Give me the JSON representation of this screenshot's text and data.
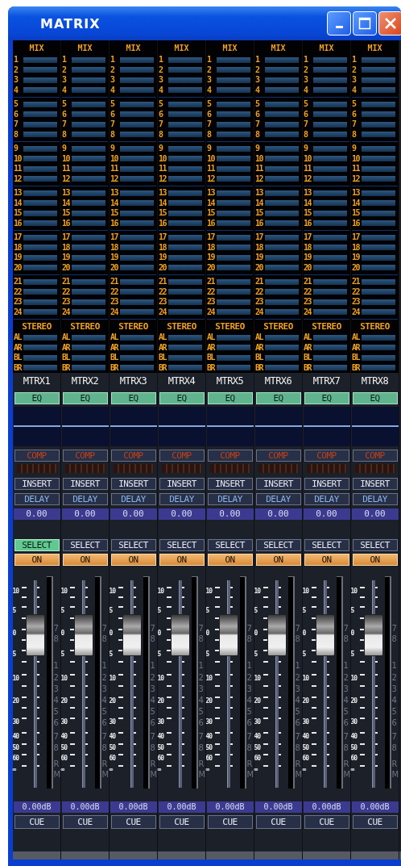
{
  "window": {
    "title": "MATRIX"
  },
  "channels": [
    {
      "mix_label": "MIX",
      "sends": [
        "1",
        "2",
        "3",
        "4",
        "5",
        "6",
        "7",
        "8",
        "9",
        "10",
        "11",
        "12",
        "13",
        "14",
        "15",
        "16",
        "17",
        "18",
        "19",
        "20",
        "21",
        "22",
        "23",
        "24"
      ],
      "stereo_label": "STEREO",
      "stereo_sends": [
        "AL",
        "AR",
        "BL",
        "BR"
      ],
      "name": "MTRX1",
      "eq": "EQ",
      "comp": "COMP",
      "insert": "INSERT",
      "delay": "DELAY",
      "delay_time": "0.00",
      "select": {
        "label": "SELECT",
        "selected": true
      },
      "on": {
        "label": "ON",
        "on": true
      },
      "fader_scale": [
        "10",
        "5",
        "0",
        "5",
        "10",
        "20",
        "30",
        "40",
        "50",
        "60",
        "∞"
      ],
      "meter_labels": [
        "7",
        "8",
        "1",
        "2",
        "3",
        "4",
        "5",
        "6",
        "7",
        "8",
        "R",
        "M"
      ],
      "level": 0.74,
      "gain": "0.00dB",
      "cue": "CUE"
    },
    {
      "mix_label": "MIX",
      "sends": [
        "1",
        "2",
        "3",
        "4",
        "5",
        "6",
        "7",
        "8",
        "9",
        "10",
        "11",
        "12",
        "13",
        "14",
        "15",
        "16",
        "17",
        "18",
        "19",
        "20",
        "21",
        "22",
        "23",
        "24"
      ],
      "stereo_label": "STEREO",
      "stereo_sends": [
        "AL",
        "AR",
        "BL",
        "BR"
      ],
      "name": "MTRX2",
      "eq": "EQ",
      "comp": "COMP",
      "insert": "INSERT",
      "delay": "DELAY",
      "delay_time": "0.00",
      "select": {
        "label": "SELECT",
        "selected": false
      },
      "on": {
        "label": "ON",
        "on": true
      },
      "fader_scale": [
        "10",
        "5",
        "0",
        "5",
        "10",
        "20",
        "30",
        "40",
        "50",
        "60",
        "∞"
      ],
      "meter_labels": [
        "7",
        "8",
        "1",
        "2",
        "3",
        "4",
        "5",
        "6",
        "7",
        "8",
        "R",
        "M"
      ],
      "level": 0.74,
      "gain": "0.00dB",
      "cue": "CUE"
    },
    {
      "mix_label": "MIX",
      "sends": [
        "1",
        "2",
        "3",
        "4",
        "5",
        "6",
        "7",
        "8",
        "9",
        "10",
        "11",
        "12",
        "13",
        "14",
        "15",
        "16",
        "17",
        "18",
        "19",
        "20",
        "21",
        "22",
        "23",
        "24"
      ],
      "stereo_label": "STEREO",
      "stereo_sends": [
        "AL",
        "AR",
        "BL",
        "BR"
      ],
      "name": "MTRX3",
      "eq": "EQ",
      "comp": "COMP",
      "insert": "INSERT",
      "delay": "DELAY",
      "delay_time": "0.00",
      "select": {
        "label": "SELECT",
        "selected": false
      },
      "on": {
        "label": "ON",
        "on": true
      },
      "fader_scale": [
        "10",
        "5",
        "0",
        "5",
        "10",
        "20",
        "30",
        "40",
        "50",
        "60",
        "∞"
      ],
      "meter_labels": [
        "7",
        "8",
        "1",
        "2",
        "3",
        "4",
        "5",
        "6",
        "7",
        "8",
        "R",
        "M"
      ],
      "level": 0.74,
      "gain": "0.00dB",
      "cue": "CUE"
    },
    {
      "mix_label": "MIX",
      "sends": [
        "1",
        "2",
        "3",
        "4",
        "5",
        "6",
        "7",
        "8",
        "9",
        "10",
        "11",
        "12",
        "13",
        "14",
        "15",
        "16",
        "17",
        "18",
        "19",
        "20",
        "21",
        "22",
        "23",
        "24"
      ],
      "stereo_label": "STEREO",
      "stereo_sends": [
        "AL",
        "AR",
        "BL",
        "BR"
      ],
      "name": "MTRX4",
      "eq": "EQ",
      "comp": "COMP",
      "insert": "INSERT",
      "delay": "DELAY",
      "delay_time": "0.00",
      "select": {
        "label": "SELECT",
        "selected": false
      },
      "on": {
        "label": "ON",
        "on": true
      },
      "fader_scale": [
        "10",
        "5",
        "0",
        "5",
        "10",
        "20",
        "30",
        "40",
        "50",
        "60",
        "∞"
      ],
      "meter_labels": [
        "7",
        "8",
        "1",
        "2",
        "3",
        "4",
        "5",
        "6",
        "7",
        "8",
        "R",
        "M"
      ],
      "level": 0.74,
      "gain": "0.00dB",
      "cue": "CUE"
    },
    {
      "mix_label": "MIX",
      "sends": [
        "1",
        "2",
        "3",
        "4",
        "5",
        "6",
        "7",
        "8",
        "9",
        "10",
        "11",
        "12",
        "13",
        "14",
        "15",
        "16",
        "17",
        "18",
        "19",
        "20",
        "21",
        "22",
        "23",
        "24"
      ],
      "stereo_label": "STEREO",
      "stereo_sends": [
        "AL",
        "AR",
        "BL",
        "BR"
      ],
      "name": "MTRX5",
      "eq": "EQ",
      "comp": "COMP",
      "insert": "INSERT",
      "delay": "DELAY",
      "delay_time": "0.00",
      "select": {
        "label": "SELECT",
        "selected": false
      },
      "on": {
        "label": "ON",
        "on": true
      },
      "fader_scale": [
        "10",
        "5",
        "0",
        "5",
        "10",
        "20",
        "30",
        "40",
        "50",
        "60",
        "∞"
      ],
      "meter_labels": [
        "7",
        "8",
        "1",
        "2",
        "3",
        "4",
        "5",
        "6",
        "7",
        "8",
        "R",
        "M"
      ],
      "level": 0.74,
      "gain": "0.00dB",
      "cue": "CUE"
    },
    {
      "mix_label": "MIX",
      "sends": [
        "1",
        "2",
        "3",
        "4",
        "5",
        "6",
        "7",
        "8",
        "9",
        "10",
        "11",
        "12",
        "13",
        "14",
        "15",
        "16",
        "17",
        "18",
        "19",
        "20",
        "21",
        "22",
        "23",
        "24"
      ],
      "stereo_label": "STEREO",
      "stereo_sends": [
        "AL",
        "AR",
        "BL",
        "BR"
      ],
      "name": "MTRX6",
      "eq": "EQ",
      "comp": "COMP",
      "insert": "INSERT",
      "delay": "DELAY",
      "delay_time": "0.00",
      "select": {
        "label": "SELECT",
        "selected": false
      },
      "on": {
        "label": "ON",
        "on": true
      },
      "fader_scale": [
        "10",
        "5",
        "0",
        "5",
        "10",
        "20",
        "30",
        "40",
        "50",
        "60",
        "∞"
      ],
      "meter_labels": [
        "7",
        "8",
        "1",
        "2",
        "3",
        "4",
        "5",
        "6",
        "7",
        "8",
        "R",
        "M"
      ],
      "level": 0.74,
      "gain": "0.00dB",
      "cue": "CUE"
    },
    {
      "mix_label": "MIX",
      "sends": [
        "1",
        "2",
        "3",
        "4",
        "5",
        "6",
        "7",
        "8",
        "9",
        "10",
        "11",
        "12",
        "13",
        "14",
        "15",
        "16",
        "17",
        "18",
        "19",
        "20",
        "21",
        "22",
        "23",
        "24"
      ],
      "stereo_label": "STEREO",
      "stereo_sends": [
        "AL",
        "AR",
        "BL",
        "BR"
      ],
      "name": "MTRX7",
      "eq": "EQ",
      "comp": "COMP",
      "insert": "INSERT",
      "delay": "DELAY",
      "delay_time": "0.00",
      "select": {
        "label": "SELECT",
        "selected": false
      },
      "on": {
        "label": "ON",
        "on": true
      },
      "fader_scale": [
        "10",
        "5",
        "0",
        "5",
        "10",
        "20",
        "30",
        "40",
        "50",
        "60",
        "∞"
      ],
      "meter_labels": [
        "7",
        "8",
        "1",
        "2",
        "3",
        "4",
        "5",
        "6",
        "7",
        "8",
        "R",
        "M"
      ],
      "level": 0.74,
      "gain": "0.00dB",
      "cue": "CUE"
    },
    {
      "mix_label": "MIX",
      "sends": [
        "1",
        "2",
        "3",
        "4",
        "5",
        "6",
        "7",
        "8",
        "9",
        "10",
        "11",
        "12",
        "13",
        "14",
        "15",
        "16",
        "17",
        "18",
        "19",
        "20",
        "21",
        "22",
        "23",
        "24"
      ],
      "stereo_label": "STEREO",
      "stereo_sends": [
        "AL",
        "AR",
        "BL",
        "BR"
      ],
      "name": "MTRX8",
      "eq": "EQ",
      "comp": "COMP",
      "insert": "INSERT",
      "delay": "DELAY",
      "delay_time": "0.00",
      "select": {
        "label": "SELECT",
        "selected": false
      },
      "on": {
        "label": "ON",
        "on": true
      },
      "fader_scale": [
        "10",
        "5",
        "0",
        "5",
        "10",
        "20",
        "30",
        "40",
        "50",
        "60",
        "∞"
      ],
      "meter_labels": [
        "7",
        "8",
        "1",
        "2",
        "3",
        "4",
        "5",
        "6",
        "7",
        "8",
        "R",
        "M"
      ],
      "level": 0.74,
      "gain": "0.00dB",
      "cue": "CUE"
    }
  ]
}
